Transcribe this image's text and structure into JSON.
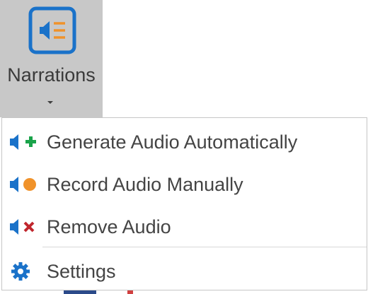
{
  "ribbon": {
    "narrations_label": "Narrations",
    "narrations_icon": "speaker-list-icon",
    "caret_icon": "dropdown-caret-icon",
    "background_color": "#c8c8c8"
  },
  "menu": {
    "items": [
      {
        "label": "Generate Audio Automatically",
        "icon": "speaker-plus-icon",
        "accent": "#1aa34a"
      },
      {
        "label": "Record Audio Manually",
        "icon": "speaker-record-icon",
        "accent": "#f0922a"
      },
      {
        "label": "Remove Audio",
        "icon": "speaker-remove-icon",
        "accent": "#c0262d"
      },
      {
        "label": "Settings",
        "icon": "gear-icon",
        "accent": "#1a72c9"
      }
    ]
  },
  "colors": {
    "speaker_blue": "#1a72c9",
    "icon_orange": "#f0922a",
    "text": "#444444"
  }
}
